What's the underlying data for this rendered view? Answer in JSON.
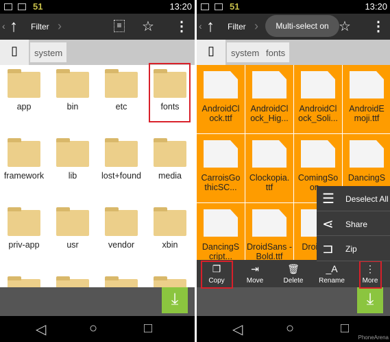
{
  "status": {
    "notif": "51",
    "time": "13:20"
  },
  "toolbar": {
    "filter": "Filter"
  },
  "left": {
    "breadcrumb": [
      "system"
    ],
    "items": [
      "app",
      "bin",
      "etc",
      "fonts",
      "framework",
      "lib",
      "lost+found",
      "media",
      "priv-app",
      "usr",
      "vendor",
      "xbin"
    ]
  },
  "right": {
    "breadcrumb": [
      "system",
      "fonts"
    ],
    "toast": "Multi-select on",
    "files": [
      "AndroidCl ock.ttf",
      "AndroidCl ock_Hig...",
      "AndroidCl ock_Soli...",
      "AndroidE moji.ttf",
      "CarroisGo thicSC...",
      "Clockopia. ttf",
      "ComingSo on...",
      "DancingS",
      "DancingS cript...",
      "DroidSans -Bold.ttf",
      "Droid t...",
      ""
    ],
    "actions": [
      {
        "label": "Copy",
        "icon": "copy-icon"
      },
      {
        "label": "Move",
        "icon": "move-icon"
      },
      {
        "label": "Delete",
        "icon": "trash-icon"
      },
      {
        "label": "Rename",
        "icon": "rename-icon"
      },
      {
        "label": "More",
        "icon": "more-icon"
      }
    ],
    "menu": [
      {
        "label": "Deselect All",
        "icon": "list-icon"
      },
      {
        "label": "Share",
        "icon": "share-icon"
      },
      {
        "label": "Zip",
        "icon": "zip-icon"
      }
    ],
    "watermark": "PhoneArena"
  },
  "colors": {
    "selected": "#fe9c00",
    "highlight": "#d8202a",
    "download": "#8bc53f"
  }
}
